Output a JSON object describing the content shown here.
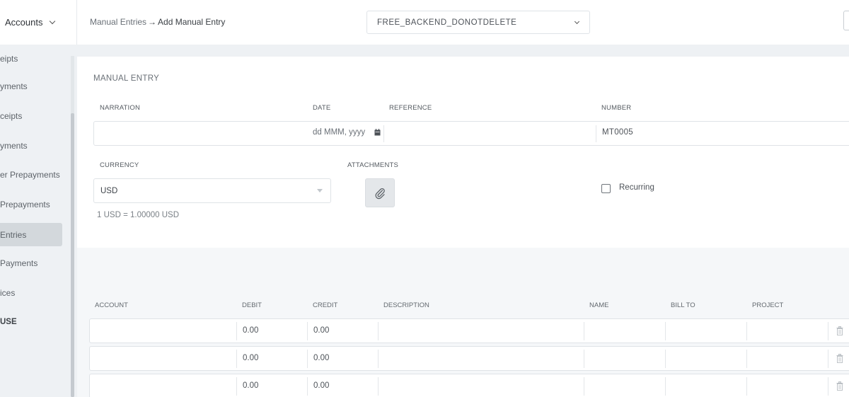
{
  "header": {
    "menu_label": "Accounts",
    "breadcrumb_parent": "Manual Entries",
    "breadcrumb_current": "Add Manual Entry",
    "organization": "FREE_BACKEND_DONOTDELETE"
  },
  "sidebar": {
    "items": [
      {
        "label": "eipts"
      },
      {
        "label": "yments"
      },
      {
        "label": "ceipts"
      },
      {
        "label": "yments"
      },
      {
        "label": "er Prepayments"
      },
      {
        "label": " Prepayments"
      },
      {
        "label": "Entries"
      },
      {
        "label": "Payments"
      },
      {
        "label": "ices"
      },
      {
        "label": "USE"
      }
    ]
  },
  "form": {
    "section_title": "MANUAL ENTRY",
    "narration_label": "NARRATION",
    "narration_value": "",
    "date_label": "DATE",
    "date_placeholder": "dd MMM, yyyy",
    "reference_label": "REFERENCE",
    "reference_value": "",
    "number_label": "NUMBER",
    "number_value": "MT0005",
    "currency_label": "CURRENCY",
    "currency_value": "USD",
    "exchange_rate": "1 USD = 1.00000 USD",
    "attachments_label": "ATTACHMENTS",
    "recurring_label": "Recurring",
    "recurring_checked": false
  },
  "lines": {
    "columns": [
      "ACCOUNT",
      "DEBIT",
      "CREDIT",
      "DESCRIPTION",
      "NAME",
      "BILL TO",
      "PROJECT"
    ],
    "rows": [
      {
        "account": "",
        "debit": "0.00",
        "credit": "0.00",
        "description": "",
        "name": "",
        "bill_to": "",
        "project": ""
      },
      {
        "account": "",
        "debit": "0.00",
        "credit": "0.00",
        "description": "",
        "name": "",
        "bill_to": "",
        "project": ""
      },
      {
        "account": "",
        "debit": "0.00",
        "credit": "0.00",
        "description": "",
        "name": "",
        "bill_to": "",
        "project": ""
      }
    ]
  },
  "icons": {
    "menu_chevron": "chevron-down-icon",
    "org_chevron": "chevron-down-icon",
    "date": "calendar-icon",
    "currency_caret": "caret-down-icon",
    "attach": "paperclip-icon",
    "row_delete": "trash-icon"
  }
}
